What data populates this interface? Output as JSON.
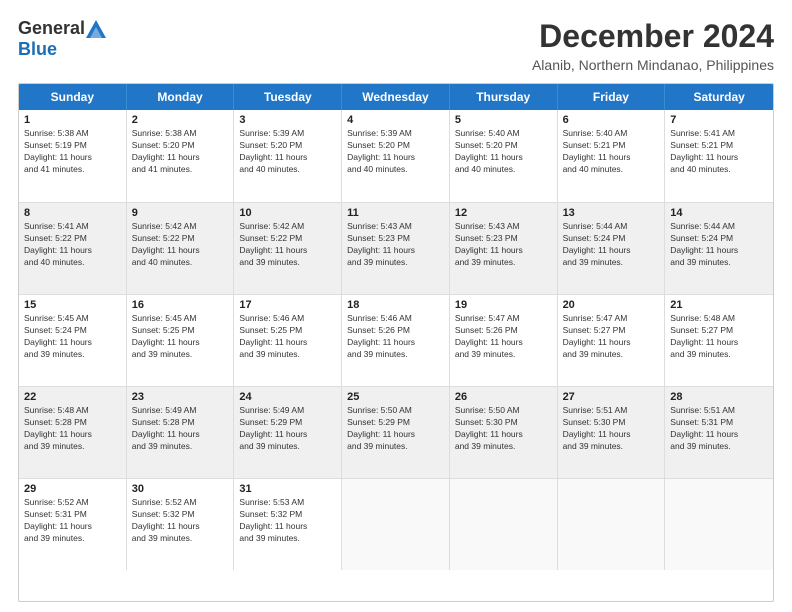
{
  "logo": {
    "general": "General",
    "blue": "Blue"
  },
  "title": "December 2024",
  "subtitle": "Alanib, Northern Mindanao, Philippines",
  "header_days": [
    "Sunday",
    "Monday",
    "Tuesday",
    "Wednesday",
    "Thursday",
    "Friday",
    "Saturday"
  ],
  "rows": [
    [
      {
        "day": "1",
        "lines": [
          "Sunrise: 5:38 AM",
          "Sunset: 5:19 PM",
          "Daylight: 11 hours",
          "and 41 minutes."
        ]
      },
      {
        "day": "2",
        "lines": [
          "Sunrise: 5:38 AM",
          "Sunset: 5:20 PM",
          "Daylight: 11 hours",
          "and 41 minutes."
        ]
      },
      {
        "day": "3",
        "lines": [
          "Sunrise: 5:39 AM",
          "Sunset: 5:20 PM",
          "Daylight: 11 hours",
          "and 40 minutes."
        ]
      },
      {
        "day": "4",
        "lines": [
          "Sunrise: 5:39 AM",
          "Sunset: 5:20 PM",
          "Daylight: 11 hours",
          "and 40 minutes."
        ]
      },
      {
        "day": "5",
        "lines": [
          "Sunrise: 5:40 AM",
          "Sunset: 5:20 PM",
          "Daylight: 11 hours",
          "and 40 minutes."
        ]
      },
      {
        "day": "6",
        "lines": [
          "Sunrise: 5:40 AM",
          "Sunset: 5:21 PM",
          "Daylight: 11 hours",
          "and 40 minutes."
        ]
      },
      {
        "day": "7",
        "lines": [
          "Sunrise: 5:41 AM",
          "Sunset: 5:21 PM",
          "Daylight: 11 hours",
          "and 40 minutes."
        ]
      }
    ],
    [
      {
        "day": "8",
        "lines": [
          "Sunrise: 5:41 AM",
          "Sunset: 5:22 PM",
          "Daylight: 11 hours",
          "and 40 minutes."
        ]
      },
      {
        "day": "9",
        "lines": [
          "Sunrise: 5:42 AM",
          "Sunset: 5:22 PM",
          "Daylight: 11 hours",
          "and 40 minutes."
        ]
      },
      {
        "day": "10",
        "lines": [
          "Sunrise: 5:42 AM",
          "Sunset: 5:22 PM",
          "Daylight: 11 hours",
          "and 39 minutes."
        ]
      },
      {
        "day": "11",
        "lines": [
          "Sunrise: 5:43 AM",
          "Sunset: 5:23 PM",
          "Daylight: 11 hours",
          "and 39 minutes."
        ]
      },
      {
        "day": "12",
        "lines": [
          "Sunrise: 5:43 AM",
          "Sunset: 5:23 PM",
          "Daylight: 11 hours",
          "and 39 minutes."
        ]
      },
      {
        "day": "13",
        "lines": [
          "Sunrise: 5:44 AM",
          "Sunset: 5:24 PM",
          "Daylight: 11 hours",
          "and 39 minutes."
        ]
      },
      {
        "day": "14",
        "lines": [
          "Sunrise: 5:44 AM",
          "Sunset: 5:24 PM",
          "Daylight: 11 hours",
          "and 39 minutes."
        ]
      }
    ],
    [
      {
        "day": "15",
        "lines": [
          "Sunrise: 5:45 AM",
          "Sunset: 5:24 PM",
          "Daylight: 11 hours",
          "and 39 minutes."
        ]
      },
      {
        "day": "16",
        "lines": [
          "Sunrise: 5:45 AM",
          "Sunset: 5:25 PM",
          "Daylight: 11 hours",
          "and 39 minutes."
        ]
      },
      {
        "day": "17",
        "lines": [
          "Sunrise: 5:46 AM",
          "Sunset: 5:25 PM",
          "Daylight: 11 hours",
          "and 39 minutes."
        ]
      },
      {
        "day": "18",
        "lines": [
          "Sunrise: 5:46 AM",
          "Sunset: 5:26 PM",
          "Daylight: 11 hours",
          "and 39 minutes."
        ]
      },
      {
        "day": "19",
        "lines": [
          "Sunrise: 5:47 AM",
          "Sunset: 5:26 PM",
          "Daylight: 11 hours",
          "and 39 minutes."
        ]
      },
      {
        "day": "20",
        "lines": [
          "Sunrise: 5:47 AM",
          "Sunset: 5:27 PM",
          "Daylight: 11 hours",
          "and 39 minutes."
        ]
      },
      {
        "day": "21",
        "lines": [
          "Sunrise: 5:48 AM",
          "Sunset: 5:27 PM",
          "Daylight: 11 hours",
          "and 39 minutes."
        ]
      }
    ],
    [
      {
        "day": "22",
        "lines": [
          "Sunrise: 5:48 AM",
          "Sunset: 5:28 PM",
          "Daylight: 11 hours",
          "and 39 minutes."
        ]
      },
      {
        "day": "23",
        "lines": [
          "Sunrise: 5:49 AM",
          "Sunset: 5:28 PM",
          "Daylight: 11 hours",
          "and 39 minutes."
        ]
      },
      {
        "day": "24",
        "lines": [
          "Sunrise: 5:49 AM",
          "Sunset: 5:29 PM",
          "Daylight: 11 hours",
          "and 39 minutes."
        ]
      },
      {
        "day": "25",
        "lines": [
          "Sunrise: 5:50 AM",
          "Sunset: 5:29 PM",
          "Daylight: 11 hours",
          "and 39 minutes."
        ]
      },
      {
        "day": "26",
        "lines": [
          "Sunrise: 5:50 AM",
          "Sunset: 5:30 PM",
          "Daylight: 11 hours",
          "and 39 minutes."
        ]
      },
      {
        "day": "27",
        "lines": [
          "Sunrise: 5:51 AM",
          "Sunset: 5:30 PM",
          "Daylight: 11 hours",
          "and 39 minutes."
        ]
      },
      {
        "day": "28",
        "lines": [
          "Sunrise: 5:51 AM",
          "Sunset: 5:31 PM",
          "Daylight: 11 hours",
          "and 39 minutes."
        ]
      }
    ],
    [
      {
        "day": "29",
        "lines": [
          "Sunrise: 5:52 AM",
          "Sunset: 5:31 PM",
          "Daylight: 11 hours",
          "and 39 minutes."
        ]
      },
      {
        "day": "30",
        "lines": [
          "Sunrise: 5:52 AM",
          "Sunset: 5:32 PM",
          "Daylight: 11 hours",
          "and 39 minutes."
        ]
      },
      {
        "day": "31",
        "lines": [
          "Sunrise: 5:53 AM",
          "Sunset: 5:32 PM",
          "Daylight: 11 hours",
          "and 39 minutes."
        ]
      },
      {
        "day": "",
        "lines": []
      },
      {
        "day": "",
        "lines": []
      },
      {
        "day": "",
        "lines": []
      },
      {
        "day": "",
        "lines": []
      }
    ]
  ]
}
